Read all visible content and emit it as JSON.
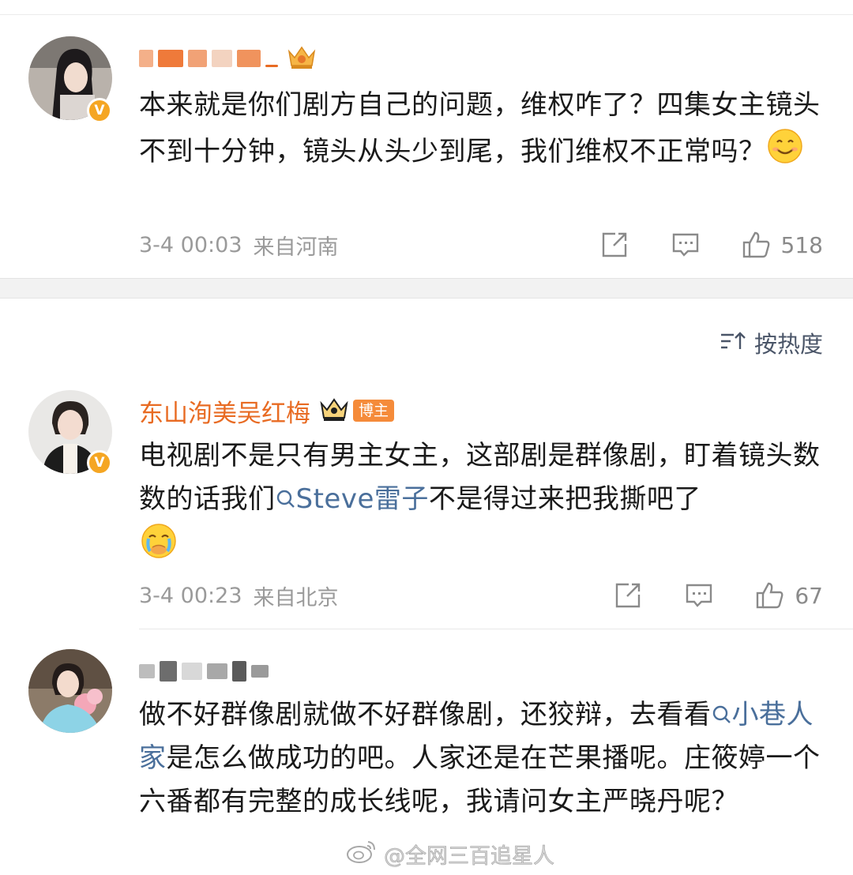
{
  "comments": [
    {
      "username": "",
      "text": "本来就是你们剧方自己的问题，维权咋了？四集女主镜头不到十分钟，镜头从头少到尾，我们维权不正常吗？",
      "emoji": "smile",
      "time": "3-4 00:03",
      "location": "来自河南",
      "likes": "518",
      "badge": "V"
    },
    {
      "username": "东山洵美吴红梅",
      "badge_label": "博主",
      "text_before": "电视剧不是只有男主女主，这部剧是群像剧，盯着镜头数数的话我们",
      "mention": "Steve雷子",
      "text_after": "不是得过来把我撕吧了",
      "emoji": "crying",
      "time": "3-4 00:23",
      "location": "来自北京",
      "likes": "67",
      "badge": "V"
    },
    {
      "username": "",
      "text_before": "做不好群像剧就做不好群像剧，还狡辩，去看看",
      "topic": "小巷人家",
      "text_after": "是怎么做成功的吧。人家还是在芒果播呢。庄筱婷一个六番都有完整的成长线呢，我请问女主严晓丹呢？"
    }
  ],
  "sort": {
    "label": "按热度",
    "icon": "sort-icon"
  },
  "watermark": "@全网三百追星人",
  "colors": {
    "accent_name": "#e86b23",
    "link": "#4a6f9b",
    "meta": "#9a9a9a",
    "verified": "#f5a623"
  }
}
